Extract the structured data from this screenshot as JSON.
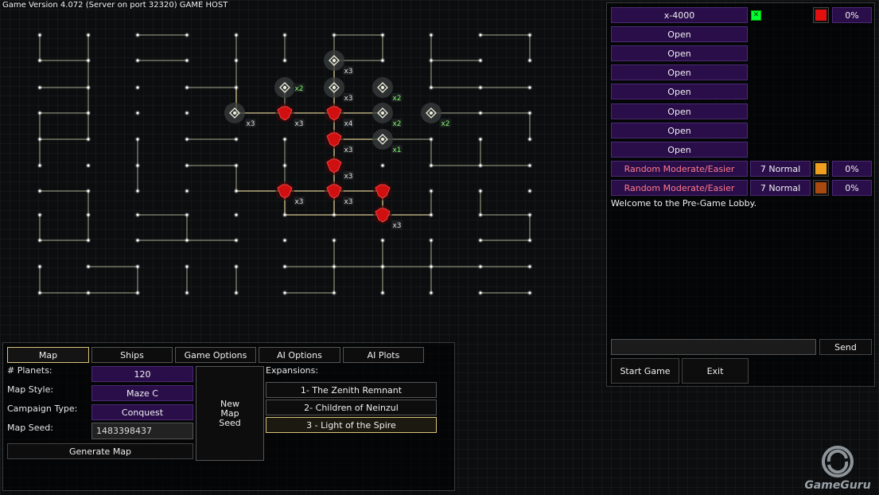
{
  "version_text": "Game Version 4.072 (Server on port 32320) GAME HOST",
  "lobby": {
    "slots": [
      {
        "name": "x-4000",
        "ai": false,
        "checked": true,
        "color": "#e01010",
        "percent": "0%"
      },
      {
        "name": "Open",
        "ai": false
      },
      {
        "name": "Open",
        "ai": false
      },
      {
        "name": "Open",
        "ai": false
      },
      {
        "name": "Open",
        "ai": false
      },
      {
        "name": "Open",
        "ai": false
      },
      {
        "name": "Open",
        "ai": false
      },
      {
        "name": "Open",
        "ai": false
      },
      {
        "name": "Random Moderate/Easier",
        "ai": true,
        "difficulty": "7 Normal",
        "color": "#f0a020",
        "percent": "0%"
      },
      {
        "name": "Random Moderate/Easier",
        "ai": true,
        "difficulty": "7 Normal",
        "color": "#a84a10",
        "percent": "0%"
      }
    ],
    "welcome": "Welcome to the Pre-Game Lobby.",
    "send_label": "Send",
    "start_label": "Start Game",
    "exit_label": "Exit"
  },
  "tabs": [
    "Map",
    "Ships",
    "Game Options",
    "AI Options",
    "AI Plots"
  ],
  "map_settings": {
    "planets_label": "# Planets:",
    "planets_value": "120",
    "style_label": "Map Style:",
    "style_value": "Maze C",
    "campaign_label": "Campaign Type:",
    "campaign_value": "Conquest",
    "seed_label": "Map Seed:",
    "seed_value": "1483398437",
    "generate_label": "Generate Map",
    "new_seed_label": "New\nMap\nSeed",
    "expansions_label": "Expansions:",
    "expansions": [
      "1- The Zenith Remnant",
      "2- Children of Neinzul",
      "3 - Light of the Spire"
    ],
    "selected_expansion": 2
  },
  "map_badges": [
    {
      "label": "x3"
    },
    {
      "label": "x2"
    },
    {
      "label": "x3"
    },
    {
      "label": "x3"
    },
    {
      "label": "x2"
    },
    {
      "label": "x3"
    },
    {
      "label": "x4"
    },
    {
      "label": "x2"
    },
    {
      "label": "x2"
    },
    {
      "label": "x3"
    },
    {
      "label": "x1"
    },
    {
      "label": "x2"
    },
    {
      "label": "x3"
    },
    {
      "label": "x3"
    },
    {
      "label": "x3"
    },
    {
      "label": "x3"
    }
  ],
  "watermark": "GameGuru"
}
